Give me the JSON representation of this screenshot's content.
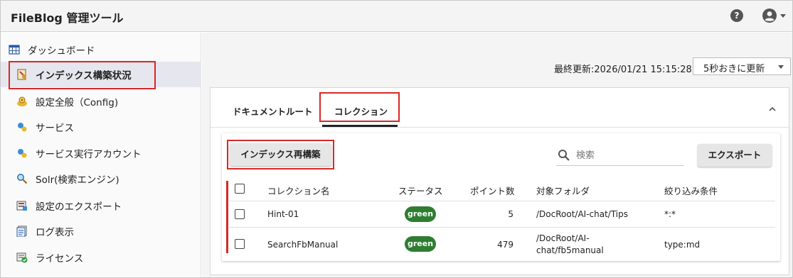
{
  "header": {
    "title": "FileBlog 管理ツール",
    "help_icon": "?"
  },
  "sidebar": {
    "items": [
      {
        "label": "ダッシュボード",
        "icon": "dashboard-icon"
      },
      {
        "label": "インデックス構築状況",
        "icon": "index-build-icon"
      },
      {
        "label": "設定全般（Config)",
        "icon": "config-icon"
      },
      {
        "label": "サービス",
        "icon": "service-icon"
      },
      {
        "label": "サービス実行アカウント",
        "icon": "service-account-icon"
      },
      {
        "label": "Solr(検索エンジン)",
        "icon": "solr-icon"
      },
      {
        "label": "設定のエクスポート",
        "icon": "export-settings-icon"
      },
      {
        "label": "ログ表示",
        "icon": "log-icon"
      },
      {
        "label": "ライセンス",
        "icon": "license-icon"
      }
    ]
  },
  "toolbar": {
    "last_updated": "最終更新:2026/01/21 15:15:28",
    "refresh_selected": "5秒おきに更新"
  },
  "tabs": [
    {
      "label": "ドキュメントルート"
    },
    {
      "label": "コレクション"
    }
  ],
  "actions": {
    "rebuild_label": "インデックス再構築",
    "search_placeholder": "検索",
    "export_label": "エクスポート"
  },
  "table": {
    "columns": [
      "コレクション名",
      "ステータス",
      "ポイント数",
      "対象フォルダ",
      "絞り込み条件"
    ],
    "rows": [
      {
        "name": "Hint-01",
        "status": "green",
        "points": "5",
        "folder_1": "/DocRoot/AI-chat/Tips",
        "folder_2": "",
        "filter": "*:*"
      },
      {
        "name": "SearchFbManual",
        "status": "green",
        "points": "479",
        "folder_1": "/DocRoot/AI-",
        "folder_2": "chat/fb5manual",
        "filter": "type:md"
      }
    ]
  },
  "colors": {
    "highlight": "#d62828",
    "status_green": "#2e7d32",
    "active_bg": "#e6e6ee"
  }
}
